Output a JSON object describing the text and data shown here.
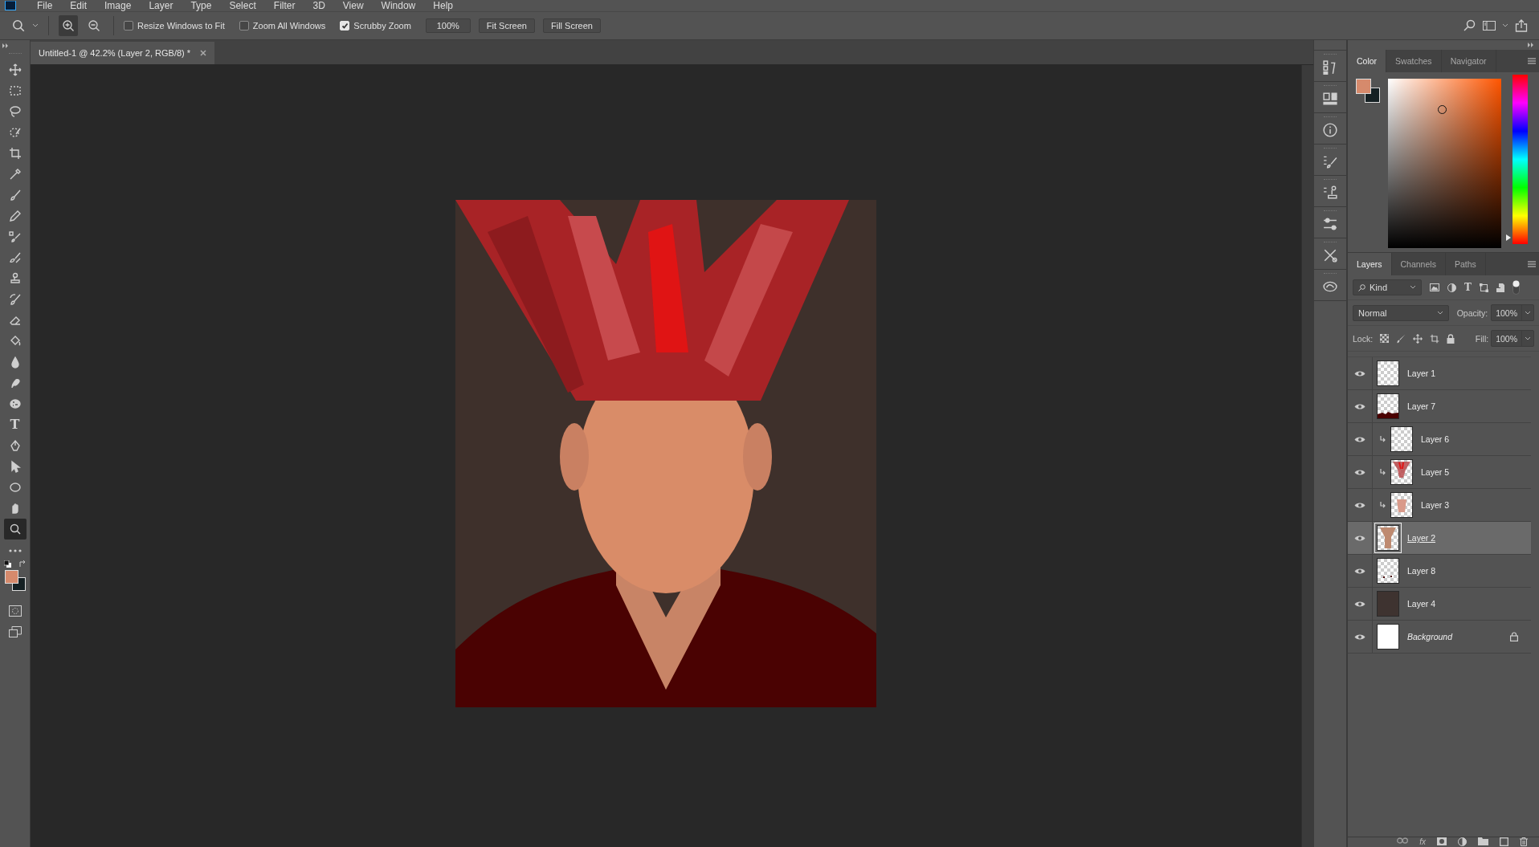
{
  "menu": [
    "File",
    "Edit",
    "Image",
    "Layer",
    "Type",
    "Select",
    "Filter",
    "3D",
    "View",
    "Window",
    "Help"
  ],
  "options_bar": {
    "zoom_in_selected": true,
    "checkboxes": [
      {
        "label": "Resize Windows to Fit",
        "checked": false
      },
      {
        "label": "Zoom All Windows",
        "checked": false
      },
      {
        "label": "Scrubby Zoom",
        "checked": true
      }
    ],
    "buttons": [
      "100%",
      "Fit Screen",
      "Fill Screen"
    ]
  },
  "document_tab": {
    "title": "Untitled-1 @ 42.2% (Layer 2, RGB/8) *"
  },
  "tools": [
    {
      "kind": "move",
      "selected": false
    },
    {
      "kind": "marquee",
      "selected": false
    },
    {
      "kind": "lasso",
      "selected": false
    },
    {
      "kind": "quick-select",
      "selected": false
    },
    {
      "kind": "crop",
      "selected": false
    },
    {
      "kind": "eyedropper",
      "selected": false
    },
    {
      "kind": "brush",
      "selected": false
    },
    {
      "kind": "pencil",
      "selected": false
    },
    {
      "kind": "clone-brush",
      "selected": false
    },
    {
      "kind": "mixer-brush",
      "selected": false
    },
    {
      "kind": "stamp",
      "selected": false
    },
    {
      "kind": "history-brush",
      "selected": false
    },
    {
      "kind": "eraser",
      "selected": false
    },
    {
      "kind": "bucket",
      "selected": false
    },
    {
      "kind": "drop",
      "selected": false
    },
    {
      "kind": "smudge",
      "selected": false
    },
    {
      "kind": "sponge",
      "selected": false
    },
    {
      "kind": "type",
      "glyph": "T",
      "selected": false
    },
    {
      "kind": "pen",
      "selected": false
    },
    {
      "kind": "arrow",
      "selected": false
    },
    {
      "kind": "ellipse",
      "selected": false
    },
    {
      "kind": "hand",
      "selected": false
    },
    {
      "kind": "zoom",
      "selected": true
    }
  ],
  "color_panel": {
    "tabs": [
      {
        "label": "Color",
        "selected": true
      },
      {
        "label": "Swatches",
        "selected": false
      },
      {
        "label": "Navigator",
        "selected": false
      }
    ],
    "hue": {
      "level": 0.04
    }
  },
  "layers_panel": {
    "tabs": [
      {
        "label": "Layers",
        "selected": true
      },
      {
        "label": "Channels",
        "selected": false
      },
      {
        "label": "Paths",
        "selected": false
      }
    ],
    "filter": "Kind",
    "type_filter_glyph": "T",
    "blend_mode": "Normal",
    "opacity_label": "Opacity:",
    "opacity": "100%",
    "lock_label": "Lock:",
    "fill_label": "Fill:",
    "fill": "100%",
    "layers": [
      {
        "name": "Layer 1",
        "visible": true,
        "clipped": false,
        "selected": false,
        "thumbnail": {
          "kind": "transparent"
        },
        "italic": false,
        "locked": false
      },
      {
        "name": "Layer 7",
        "visible": true,
        "clipped": false,
        "selected": false,
        "thumbnail": {
          "kind": "bottom-shape"
        },
        "italic": false,
        "locked": false
      },
      {
        "name": "Layer 6",
        "visible": true,
        "clipped": true,
        "selected": false,
        "thumbnail": {
          "kind": "transparent"
        },
        "italic": false,
        "locked": false
      },
      {
        "name": "Layer 5",
        "visible": true,
        "clipped": true,
        "selected": false,
        "thumbnail": {
          "kind": "red-strokes"
        },
        "italic": false,
        "locked": false
      },
      {
        "name": "Layer 3",
        "visible": true,
        "clipped": true,
        "selected": false,
        "thumbnail": {
          "kind": "pink-shape"
        },
        "italic": false,
        "locked": false
      },
      {
        "name": "Layer 2",
        "visible": true,
        "clipped": false,
        "selected": true,
        "thumbnail": {
          "kind": "tan-shape"
        },
        "italic": false,
        "locked": false
      },
      {
        "name": "Layer 8",
        "visible": true,
        "clipped": false,
        "selected": false,
        "thumbnail": {
          "kind": "dots"
        },
        "italic": false,
        "locked": false
      },
      {
        "name": "Layer 4",
        "visible": true,
        "clipped": false,
        "selected": false,
        "thumbnail": {
          "kind": "dark"
        },
        "italic": false,
        "locked": false
      },
      {
        "name": "Background",
        "visible": true,
        "clipped": false,
        "selected": false,
        "thumbnail": {
          "kind": "white"
        },
        "italic": true,
        "locked": true
      }
    ],
    "footer_glyph": "fx"
  }
}
